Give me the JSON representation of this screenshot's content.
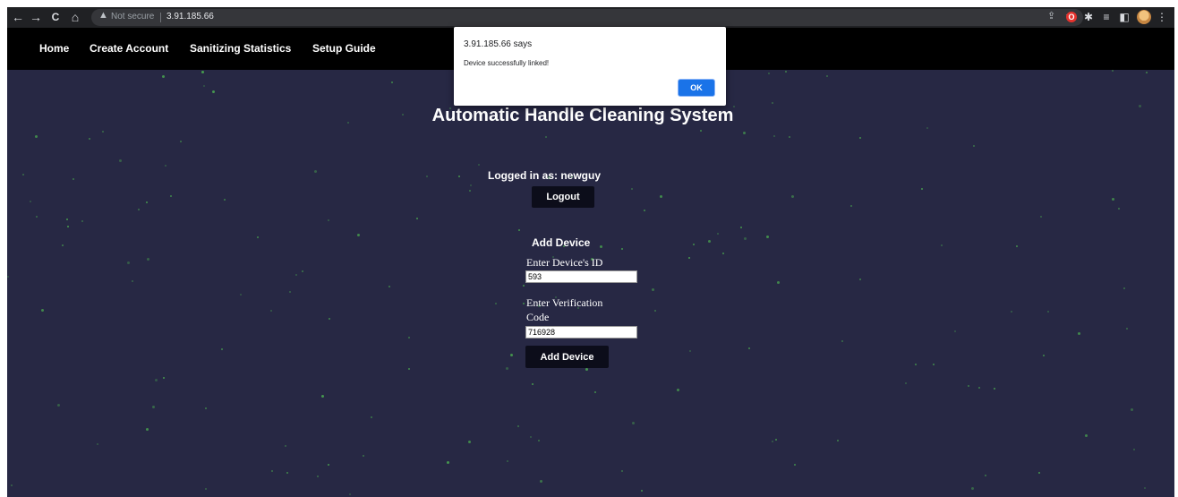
{
  "browser": {
    "back_icon": "←",
    "forward_icon": "→",
    "reload_icon": "C",
    "home_icon": "⌂",
    "secure_icon": "▲",
    "secure_label": "Not secure",
    "url": "3.91.185.66",
    "share_icon": "⇪",
    "bookmark_icon": "☆",
    "ext_opera_icon": "O",
    "ext_puzzle_icon": "✱",
    "reading_list_icon": "≡",
    "side_panel_icon": "◧",
    "menu_icon": "⋮"
  },
  "nav": {
    "items": [
      {
        "label": "Home"
      },
      {
        "label": "Create Account"
      },
      {
        "label": "Sanitizing Statistics"
      },
      {
        "label": "Setup Guide"
      }
    ]
  },
  "main": {
    "title": "Automatic Handle Cleaning System",
    "logged_in_text": "Logged in as: newguy",
    "logout_label": "Logout",
    "add_device_heading": "Add Device",
    "device_id_label": "Enter Device's ID",
    "device_id_value": "593",
    "verify_label": "Enter Verification Code",
    "verify_code_value": "716928",
    "add_device_button_label": "Add Device"
  },
  "alert": {
    "title": "3.91.185.66 says",
    "message": "Device successfully linked!",
    "ok_label": "OK"
  },
  "colors": {
    "page_background": "#272844",
    "nav_background": "#000000",
    "button_background": "#0c0d1a",
    "star_color": "#4caf50",
    "dialog_accent": "#1a73e8"
  }
}
